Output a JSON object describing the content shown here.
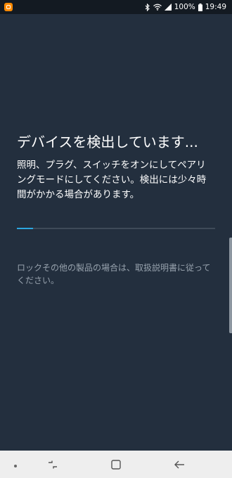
{
  "status_bar": {
    "battery": "100%",
    "time": "19:49"
  },
  "main": {
    "title": "デバイスを検出しています...",
    "description": "照明、プラグ、スイッチをオンにしてペアリングモードにしてください。検出には少々時間がかかる場合があります。",
    "progress": 0.08,
    "note": "ロックその他の製品の場合は、取扱説明書に従ってください。"
  },
  "colors": {
    "background": "#232f3e",
    "status_bar": "#131a22",
    "accent": "#2ca6e0",
    "app_icon": "#ff8a00",
    "nav_bar": "#eeeeee"
  },
  "icons": {
    "status_left": "app-notification-icon",
    "status_right": [
      "bluetooth-icon",
      "wifi-icon",
      "signal-icon",
      "battery-icon"
    ],
    "nav": [
      "recent-apps-icon",
      "home-icon",
      "back-icon"
    ]
  }
}
